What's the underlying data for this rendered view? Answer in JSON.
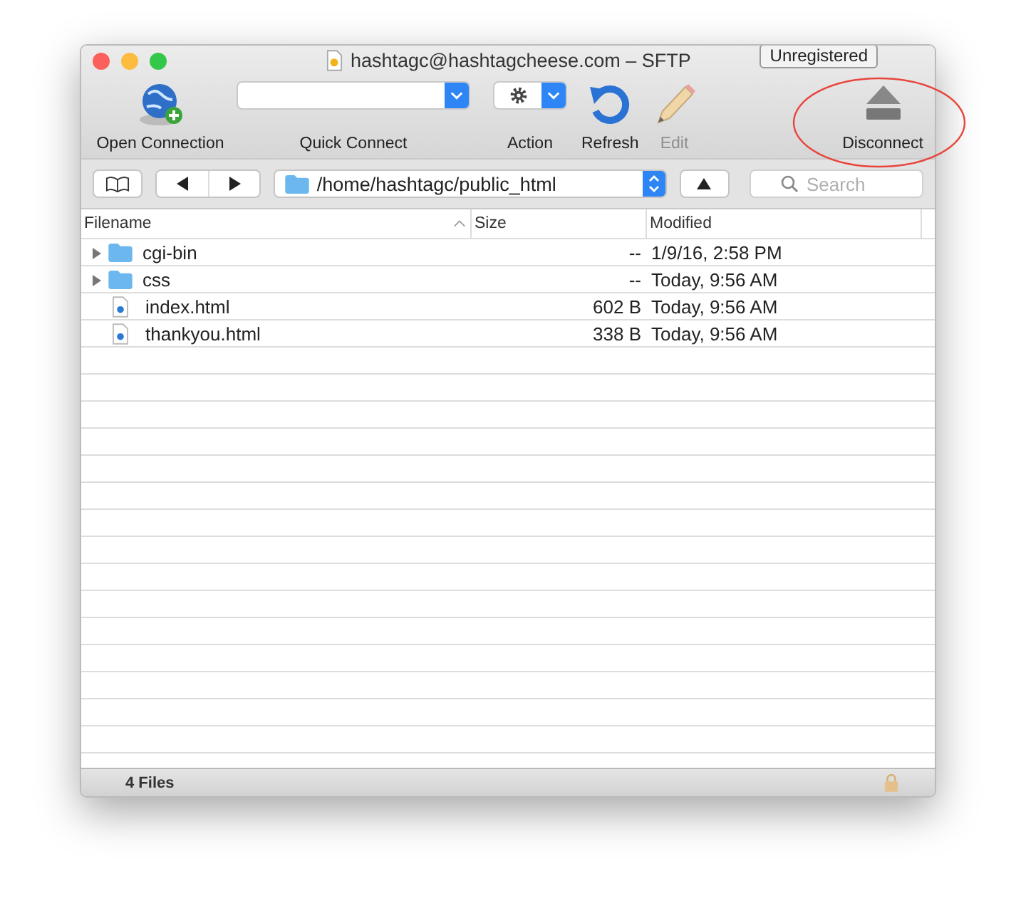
{
  "window": {
    "title": "hashtagc@hashtagcheese.com – SFTP",
    "badge": "Unregistered"
  },
  "toolbar": [
    {
      "kind": "open",
      "label": "Open Connection",
      "disabled": false
    },
    {
      "kind": "quick",
      "label": "Quick Connect",
      "disabled": false
    },
    {
      "kind": "action",
      "label": "Action",
      "disabled": false
    },
    {
      "kind": "refresh",
      "label": "Refresh",
      "disabled": false
    },
    {
      "kind": "edit",
      "label": "Edit",
      "disabled": true
    },
    {
      "kind": "disconnect",
      "label": "Disconnect",
      "disabled": false
    }
  ],
  "path": "/home/hashtagc/public_html",
  "search": {
    "placeholder": "Search"
  },
  "table": {
    "columns": [
      "Filename",
      "Size",
      "Modified"
    ],
    "rows": [
      {
        "kind": "folder",
        "expanded": false,
        "name": "cgi-bin",
        "size": "--",
        "modified": "1/9/16, 2:58 PM"
      },
      {
        "kind": "folder",
        "expanded": false,
        "name": "css",
        "size": "--",
        "modified": "Today, 9:56 AM"
      },
      {
        "kind": "file",
        "name": "index.html",
        "size": "602 B",
        "modified": "Today, 9:56 AM"
      },
      {
        "kind": "file",
        "name": "thankyou.html",
        "size": "338 B",
        "modified": "Today, 9:56 AM"
      }
    ]
  },
  "status_bar": {
    "text": "4 Files"
  }
}
